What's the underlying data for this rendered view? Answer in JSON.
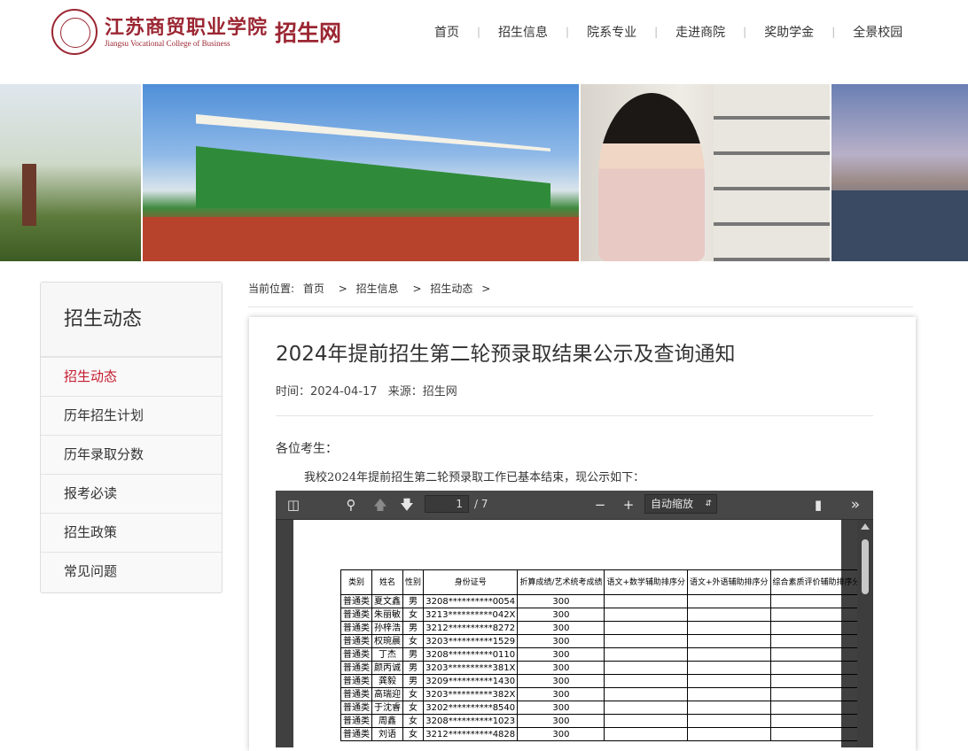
{
  "header": {
    "logo_cn": "江苏商贸职业学院",
    "logo_en": "Jiangsu Vocational College of Business",
    "site_name": "招生网",
    "nav": [
      "首页",
      "招生信息",
      "院系专业",
      "走进商院",
      "奖助学金",
      "全景校园"
    ],
    "nav_separator": "|"
  },
  "sidebar": {
    "title": "招生动态",
    "items": [
      "招生动态",
      "历年招生计划",
      "历年录取分数",
      "报考必读",
      "招生政策",
      "常见问题"
    ],
    "active_index": 0
  },
  "breadcrumb": {
    "label": "当前位置:",
    "items": [
      "首页",
      "招生信息",
      "招生动态"
    ],
    "separator": ">"
  },
  "article": {
    "title": "2024年提前招生第二轮预录取结果公示及查询通知",
    "time_label": "时间：2024-04-17",
    "source_label": "来源：招生网",
    "greeting": "各位考生：",
    "paragraph": "我校2024年提前招生第二轮预录取工作已基本结束，现公示如下："
  },
  "pdf_viewer": {
    "page_current": "1",
    "page_total": "/ 7",
    "zoom": "自动缩放",
    "icons": [
      "sidebar-toggle-icon",
      "search-icon",
      "arrow-up-icon",
      "arrow-down-icon",
      "zoom-out-icon",
      "zoom-in-icon",
      "bookmark-icon",
      "more-icon"
    ],
    "table": {
      "headers": [
        "类别",
        "姓名",
        "性别",
        "身份证号",
        "折算成绩/艺术统考成绩",
        "语文+数学辅助排序分",
        "语文+外语辅助排序分",
        "综合素质评价辅助排序分"
      ],
      "rows": [
        [
          "普通类",
          "夏文鑫",
          "男",
          "3208**********0054",
          "300",
          "",
          "",
          ""
        ],
        [
          "普通类",
          "朱丽敏",
          "女",
          "3213**********042X",
          "300",
          "",
          "",
          ""
        ],
        [
          "普通类",
          "孙梓浩",
          "男",
          "3212**********8272",
          "300",
          "",
          "",
          ""
        ],
        [
          "普通类",
          "权琬晨",
          "女",
          "3203**********1529",
          "300",
          "",
          "",
          ""
        ],
        [
          "普通类",
          "丁杰",
          "男",
          "3208**********0110",
          "300",
          "",
          "",
          ""
        ],
        [
          "普通类",
          "颜丙诚",
          "男",
          "3203**********381X",
          "300",
          "",
          "",
          ""
        ],
        [
          "普通类",
          "龚毅",
          "男",
          "3209**********1430",
          "300",
          "",
          "",
          ""
        ],
        [
          "普通类",
          "高瑞迎",
          "女",
          "3203**********382X",
          "300",
          "",
          "",
          ""
        ],
        [
          "普通类",
          "于沈睿",
          "女",
          "3202**********8540",
          "300",
          "",
          "",
          ""
        ],
        [
          "普通类",
          "周鑫",
          "女",
          "3208**********1023",
          "300",
          "",
          "",
          ""
        ],
        [
          "普通类",
          "刘语",
          "女",
          "3212**********4828",
          "300",
          "",
          "",
          ""
        ]
      ]
    }
  },
  "colors": {
    "brand": "#9b2632",
    "active_link": "#c41b2e",
    "pdf_toolbar": "#474747"
  }
}
